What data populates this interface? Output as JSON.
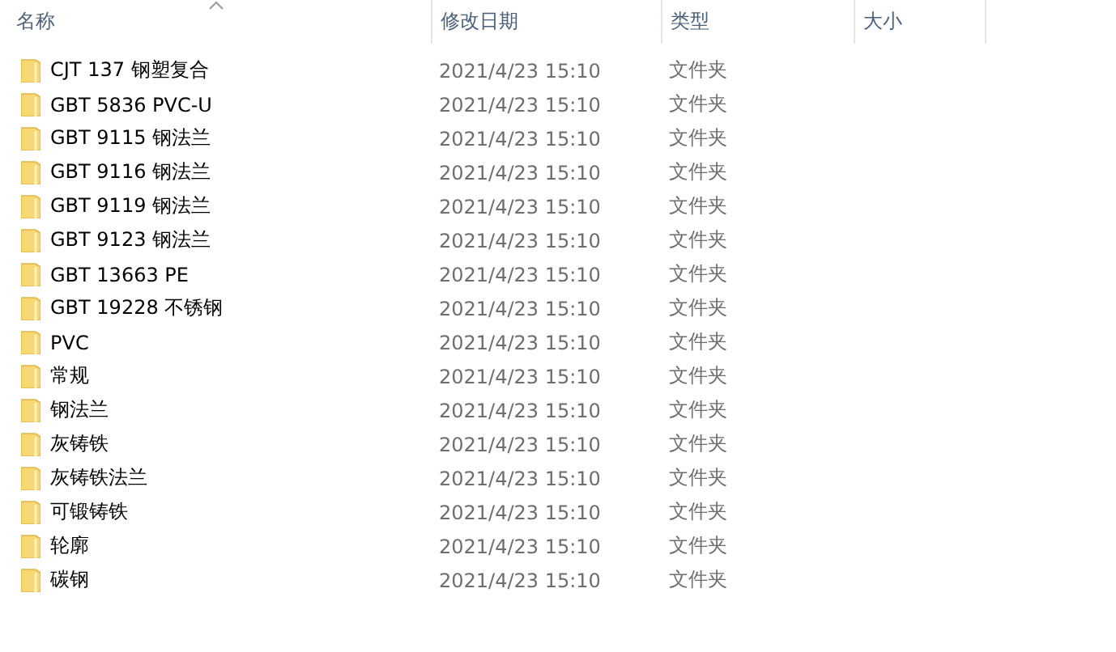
{
  "columns": [
    {
      "label": "名称",
      "sorted": true
    },
    {
      "label": "修改日期",
      "sorted": false
    },
    {
      "label": "类型",
      "sorted": false
    },
    {
      "label": "大小",
      "sorted": false
    }
  ],
  "rows": [
    {
      "name": "CJT 137 钢塑复合",
      "modified": "2021/4/23 15:10",
      "type": "文件夹"
    },
    {
      "name": "GBT 5836 PVC-U",
      "modified": "2021/4/23 15:10",
      "type": "文件夹"
    },
    {
      "name": "GBT 9115 钢法兰",
      "modified": "2021/4/23 15:10",
      "type": "文件夹"
    },
    {
      "name": "GBT 9116 钢法兰",
      "modified": "2021/4/23 15:10",
      "type": "文件夹"
    },
    {
      "name": "GBT 9119 钢法兰",
      "modified": "2021/4/23 15:10",
      "type": "文件夹"
    },
    {
      "name": "GBT 9123 钢法兰",
      "modified": "2021/4/23 15:10",
      "type": "文件夹"
    },
    {
      "name": "GBT 13663 PE",
      "modified": "2021/4/23 15:10",
      "type": "文件夹"
    },
    {
      "name": "GBT 19228 不锈钢",
      "modified": "2021/4/23 15:10",
      "type": "文件夹"
    },
    {
      "name": "PVC",
      "modified": "2021/4/23 15:10",
      "type": "文件夹"
    },
    {
      "name": "常规",
      "modified": "2021/4/23 15:10",
      "type": "文件夹"
    },
    {
      "name": "钢法兰",
      "modified": "2021/4/23 15:10",
      "type": "文件夹"
    },
    {
      "name": "灰铸铁",
      "modified": "2021/4/23 15:10",
      "type": "文件夹"
    },
    {
      "name": "灰铸铁法兰",
      "modified": "2021/4/23 15:10",
      "type": "文件夹"
    },
    {
      "name": "可锻铸铁",
      "modified": "2021/4/23 15:10",
      "type": "文件夹"
    },
    {
      "name": "轮廓",
      "modified": "2021/4/23 15:10",
      "type": "文件夹"
    },
    {
      "name": "碳钢",
      "modified": "2021/4/23 15:10",
      "type": "文件夹"
    }
  ]
}
